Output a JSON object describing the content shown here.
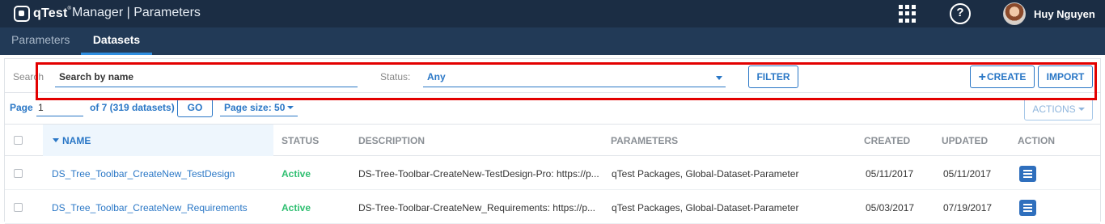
{
  "topbar": {
    "brand": "qTest",
    "brand_mark": "®",
    "app_title": "Manager | Parameters",
    "user_name": "Huy Nguyen",
    "help_glyph": "?",
    "icons": [
      "grid-apps-icon",
      "help-icon",
      "user-avatar"
    ]
  },
  "subnav": {
    "tabs": [
      {
        "label": "Parameters",
        "active": false
      },
      {
        "label": "Datasets",
        "active": true
      }
    ]
  },
  "filters": {
    "search_label": "Search",
    "search_placeholder": "Search by name",
    "status_label": "Status:",
    "status_value": "Any",
    "filter_button": "FILTER",
    "create_button": "CREATE",
    "create_icon": "+",
    "import_button": "IMPORT"
  },
  "pagination": {
    "page_label": "Page",
    "page_value": "1",
    "of_text": "of 7 (319 datasets)",
    "go_button": "GO",
    "page_size_label": "Page size: 50",
    "actions_button": "ACTIONS"
  },
  "table": {
    "columns": [
      "NAME",
      "STATUS",
      "DESCRIPTION",
      "PARAMETERS",
      "CREATED",
      "UPDATED",
      "ACTION"
    ],
    "sorted_column": "NAME",
    "rows": [
      {
        "name": "DS_Tree_Toolbar_CreateNew_TestDesign",
        "status": "Active",
        "description": "DS-Tree-Toolbar-CreateNew-TestDesign-Pro: https://p...",
        "parameters": "qTest Packages, Global-Dataset-Parameter",
        "created": "05/11/2017",
        "updated": "05/11/2017"
      },
      {
        "name": "DS_Tree_Toolbar_CreateNew_Requirements",
        "status": "Active",
        "description": "DS-Tree-Toolbar-CreateNew_Requirements: https://p...",
        "parameters": "qTest Packages, Global-Dataset-Parameter",
        "created": "05/03/2017",
        "updated": "07/19/2017"
      }
    ]
  },
  "colors": {
    "topbar_bg": "#1b2d44",
    "subnav_bg": "#223a57",
    "accent": "#2a77c6",
    "status_active": "#2fbf71",
    "highlight": "#e30000"
  }
}
